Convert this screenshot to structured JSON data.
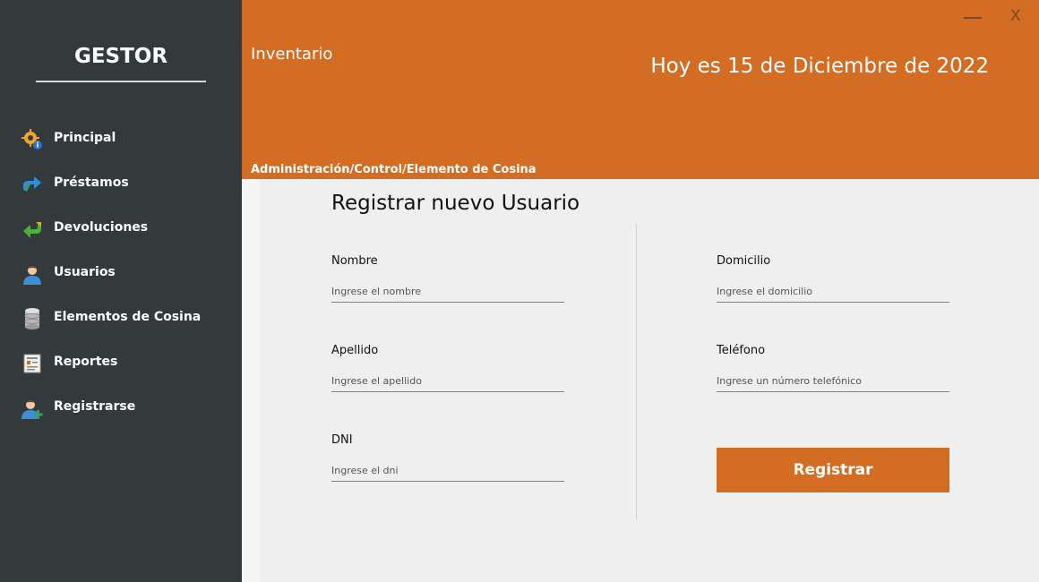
{
  "sidebar": {
    "brand": "GESTOR",
    "items": [
      {
        "label": "Principal",
        "icon": "gear-info-icon"
      },
      {
        "label": "Préstamos",
        "icon": "forward-arrow-icon"
      },
      {
        "label": "Devoluciones",
        "icon": "return-arrow-icon"
      },
      {
        "label": "Usuarios",
        "icon": "user-icon"
      },
      {
        "label": "Elementos de Cosina",
        "icon": "database-icon"
      },
      {
        "label": "Reportes",
        "icon": "report-icon"
      },
      {
        "label": "Registrarse",
        "icon": "add-user-icon"
      }
    ]
  },
  "header": {
    "app_title": "Inventario",
    "date": "Hoy es 15 de Diciembre de 2022",
    "breadcrumb": "Administración/Control/Elemento de Cosina",
    "minimize_label": "—",
    "close_label": "X"
  },
  "form": {
    "title": "Registrar nuevo Usuario",
    "nombre": {
      "label": "Nombre",
      "placeholder": "Ingrese el nombre"
    },
    "apellido": {
      "label": "Apellido",
      "placeholder": "Ingrese el apellido"
    },
    "dni": {
      "label": "DNI",
      "placeholder": "Ingrese el dni"
    },
    "domicilio": {
      "label": "Domicilio",
      "placeholder": "Ingrese el domicilio"
    },
    "telefono": {
      "label": "Teléfono",
      "placeholder": "Ingrese un número telefónico"
    },
    "submit_label": "Registrar"
  },
  "colors": {
    "accent": "#d36d23",
    "sidebar_bg": "#343a3b",
    "content_bg": "#efefef"
  }
}
